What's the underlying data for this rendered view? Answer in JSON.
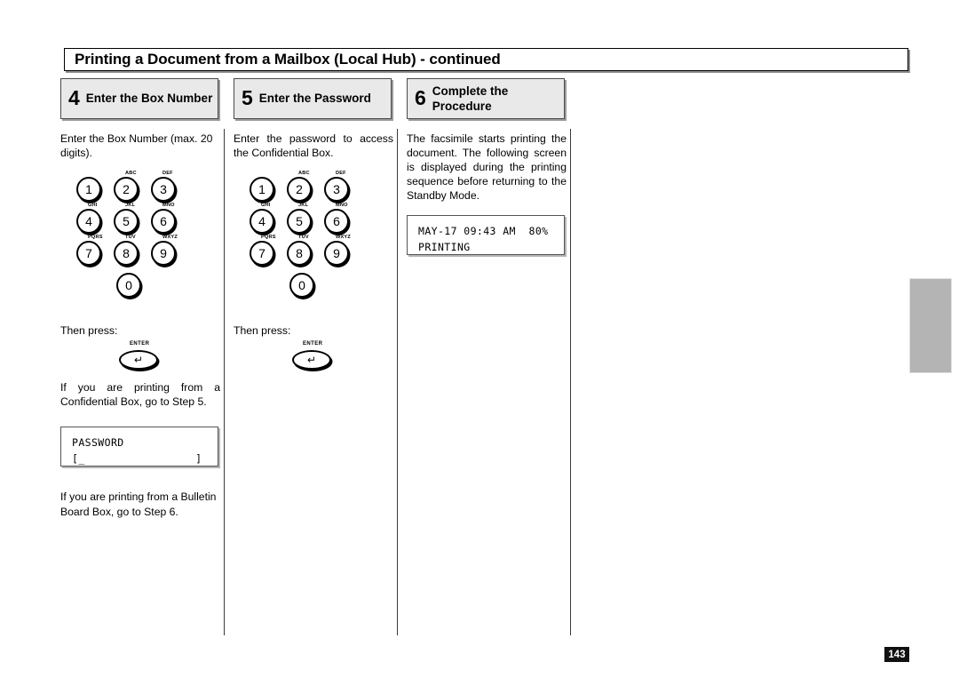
{
  "page": {
    "title": "Printing a Document from a Mailbox (Local Hub) - continued",
    "page_number": "143"
  },
  "steps": [
    {
      "number": "4",
      "label": "Enter the Box Number"
    },
    {
      "number": "5",
      "label": "Enter the Password"
    },
    {
      "number": "6",
      "label": "Complete the Procedure"
    }
  ],
  "columns": {
    "step4": {
      "intro": "Enter the Box Number (max. 20 digits).",
      "then_press": "Then press:",
      "enter_key_label": "ENTER",
      "enter_key_icon": "return-arrow",
      "confidential_note": "If you are printing from a Confidential Box, go to Step 5.",
      "lcd": {
        "line1": "PASSWORD",
        "line2": "[_                 ]"
      },
      "bulletin_note": "If you are printing from a Bulletin Board Box, go to Step 6."
    },
    "step5": {
      "intro": "Enter the password to access the Confidential Box.",
      "then_press": "Then press:",
      "enter_key_label": "ENTER",
      "enter_key_icon": "return-arrow"
    },
    "step6": {
      "intro": "The facsimile starts printing the document. The following screen is displayed during the printing sequence before returning to the Standby Mode.",
      "lcd": {
        "line1": "MAY-17 09:43 AM  80%",
        "line2": "PRINTING"
      }
    }
  },
  "keypad": {
    "keys": [
      {
        "digit": "1",
        "letters": ""
      },
      {
        "digit": "2",
        "letters": "ABC"
      },
      {
        "digit": "3",
        "letters": "DEF"
      },
      {
        "digit": "4",
        "letters": "GHI"
      },
      {
        "digit": "5",
        "letters": "JKL"
      },
      {
        "digit": "6",
        "letters": "MNO"
      },
      {
        "digit": "7",
        "letters": "PQRS"
      },
      {
        "digit": "8",
        "letters": "TUV"
      },
      {
        "digit": "9",
        "letters": "WXYZ"
      },
      {
        "digit": "0",
        "letters": ""
      }
    ]
  },
  "colors": {
    "step_box_background": "#e9e9e9",
    "edge_tab": "#b4b4b4",
    "page_number_background": "#111111",
    "text": "#000000"
  }
}
